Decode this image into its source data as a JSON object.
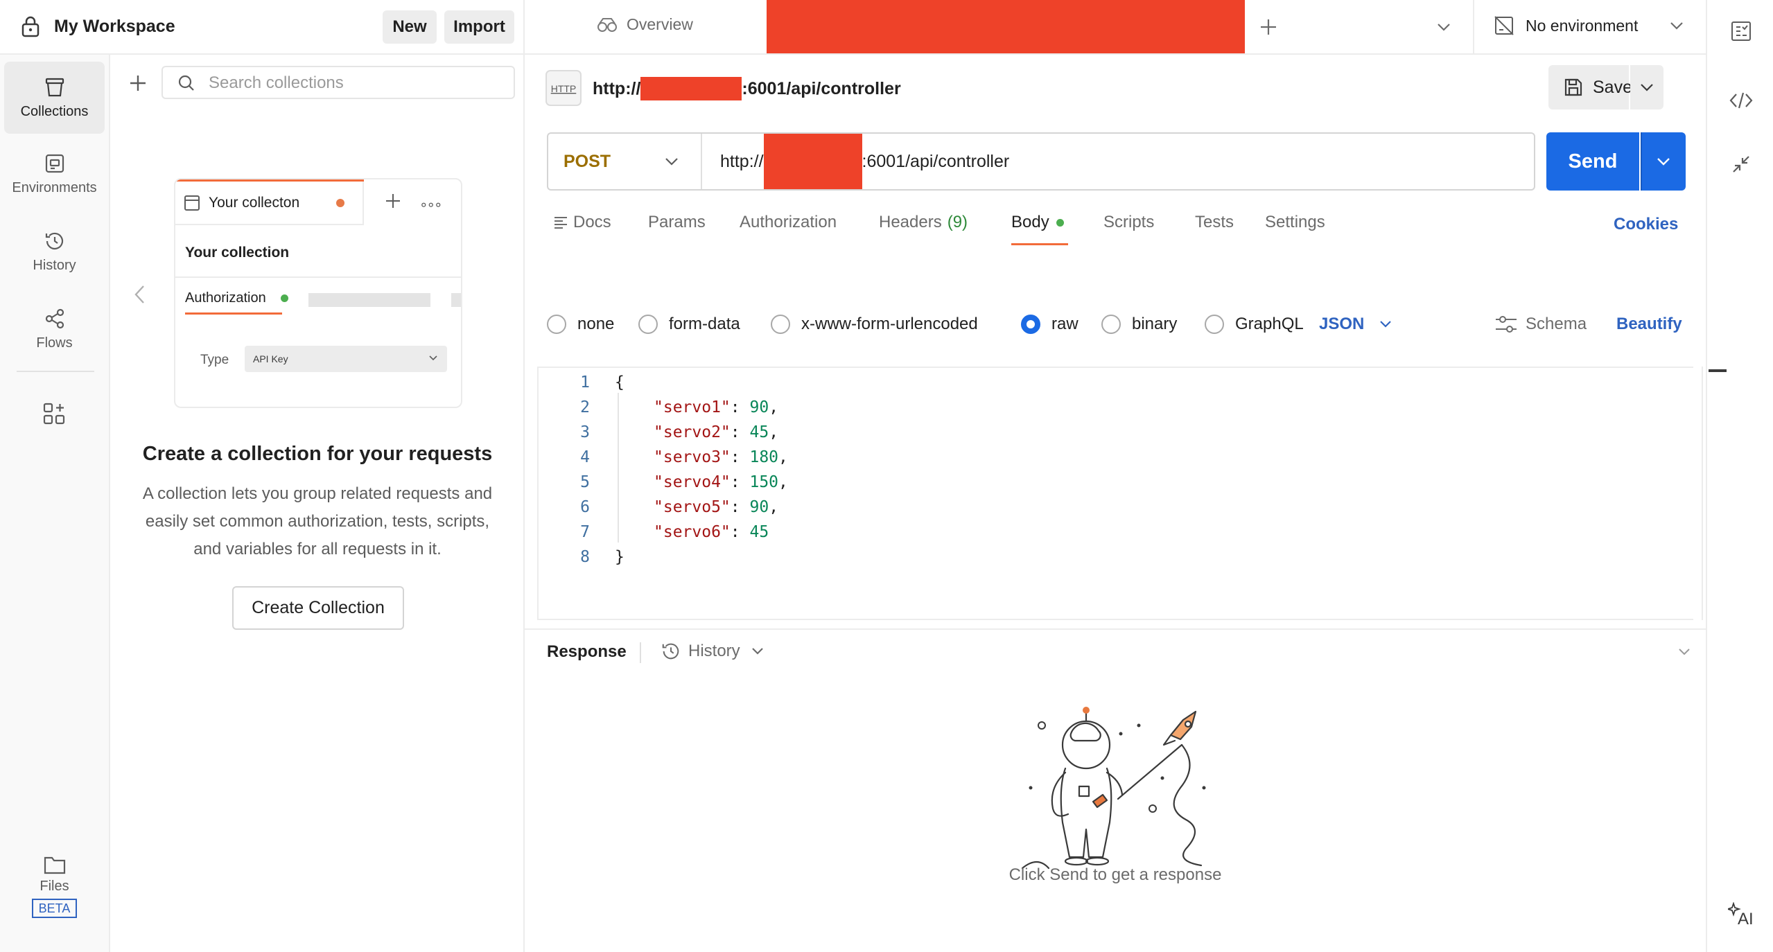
{
  "workspace": {
    "title": "My Workspace",
    "new_label": "New",
    "import_label": "Import"
  },
  "sidebar": {
    "items": [
      {
        "label": "Collections",
        "icon": "collections-icon",
        "active": true
      },
      {
        "label": "Environments",
        "icon": "environments-icon",
        "active": false
      },
      {
        "label": "History",
        "icon": "history-icon",
        "active": false
      },
      {
        "label": "Flows",
        "icon": "flows-icon",
        "active": false
      }
    ],
    "files_label": "Files",
    "files_badge": "BETA"
  },
  "collections": {
    "search_placeholder": "Search collections",
    "illustration": {
      "tab_label": "Your collecton",
      "heading": "Your collection",
      "auth_label": "Authorization",
      "type_label": "Type",
      "type_value": "API Key"
    },
    "empty_title": "Create a collection for your requests",
    "empty_description": "A collection lets you group related requests and easily set common authorization, tests, scripts, and variables for all requests in it.",
    "create_button": "Create Collection"
  },
  "tabs": {
    "overview_label": "Overview",
    "environment_label": "No environment"
  },
  "request": {
    "title_prefix": "http://",
    "title_suffix": ":6001/api/controller",
    "save_label": "Save",
    "method": "POST",
    "url_prefix": "http://",
    "url_suffix": ":6001/api/controller",
    "send_label": "Send",
    "tabs": {
      "docs": "Docs",
      "params": "Params",
      "authorization": "Authorization",
      "headers": "Headers",
      "headers_count": "(9)",
      "body": "Body",
      "scripts": "Scripts",
      "tests": "Tests",
      "settings": "Settings",
      "cookies": "Cookies"
    },
    "body_types": {
      "none": "none",
      "form_data": "form-data",
      "urlencoded": "x-www-form-urlencoded",
      "raw": "raw",
      "binary": "binary",
      "graphql": "GraphQL",
      "format": "JSON",
      "schema": "Schema",
      "beautify": "Beautify"
    },
    "body_lines": [
      {
        "n": "1",
        "text": "{"
      },
      {
        "n": "2",
        "key": "\"servo1\"",
        "value": "90",
        "comma": ","
      },
      {
        "n": "3",
        "key": "\"servo2\"",
        "value": "45",
        "comma": ","
      },
      {
        "n": "4",
        "key": "\"servo3\"",
        "value": "180",
        "comma": ","
      },
      {
        "n": "5",
        "key": "\"servo4\"",
        "value": "150",
        "comma": ","
      },
      {
        "n": "6",
        "key": "\"servo5\"",
        "value": "90",
        "comma": ","
      },
      {
        "n": "7",
        "key": "\"servo6\"",
        "value": "45",
        "comma": ""
      },
      {
        "n": "8",
        "text": "}"
      }
    ]
  },
  "response": {
    "label": "Response",
    "history_label": "History",
    "empty_text": "Click Send to get a response"
  },
  "colors": {
    "accent": "#f26b3a",
    "send": "#1b6ae4",
    "redaction": "#ee4229",
    "method_post": "#9b6e00",
    "status_dot": "#4cae4f"
  }
}
